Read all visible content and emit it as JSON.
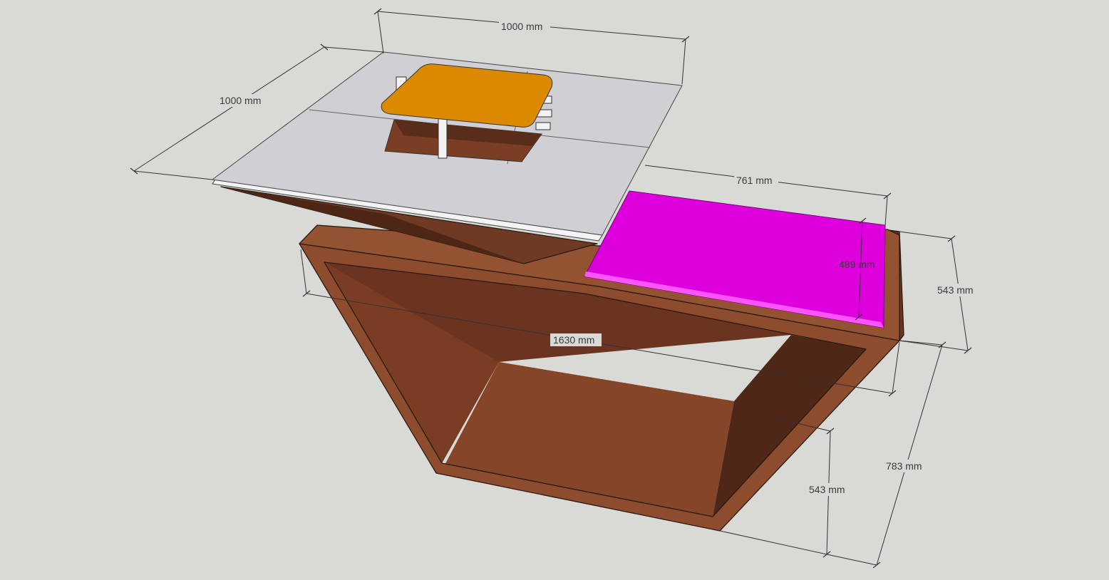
{
  "dimensions": {
    "top_width": "1000 mm",
    "top_depth": "1000 mm",
    "shelf_length": "761 mm",
    "shelf_width": "489 mm",
    "frame_depth_upper": "543 mm",
    "frame_depth_lower": "543 mm",
    "overall_length": "1630 mm",
    "overall_height": "783 mm"
  },
  "colors": {
    "background": "#d9d9d6",
    "frame_front": "#8a4a2c",
    "frame_inner_dark": "#5a2c1a",
    "frame_top_edge": "#9a5535",
    "tabletop": "#cfcfd4",
    "tabletop_edge": "#f2f2f2",
    "burner_plate": "#db8a00",
    "shelf_magenta": "#dd00dd"
  }
}
